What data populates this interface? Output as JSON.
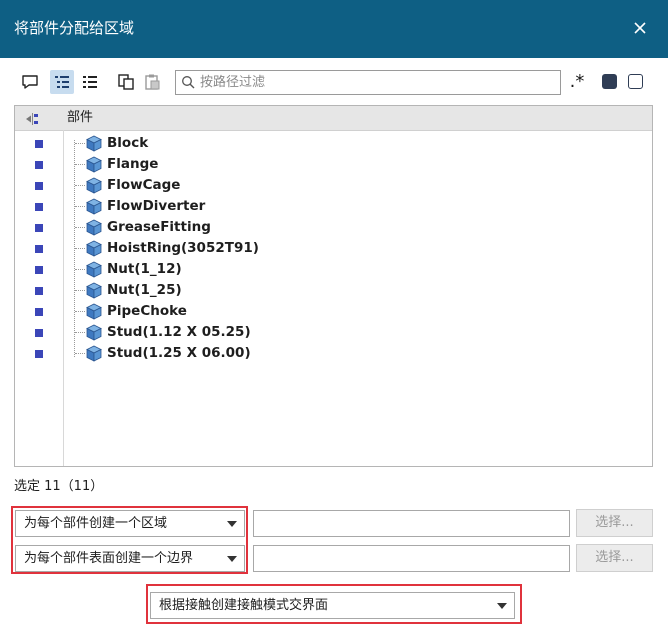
{
  "dialog": {
    "title": "将部件分配给区域"
  },
  "toolbar": {
    "search_placeholder": "按路径过滤",
    "regex_label": ".*"
  },
  "tree": {
    "header_label": "部件",
    "items": [
      {
        "label": "Block"
      },
      {
        "label": "Flange"
      },
      {
        "label": "FlowCage"
      },
      {
        "label": "FlowDiverter"
      },
      {
        "label": "GreaseFitting"
      },
      {
        "label": "HoistRing(3052T91)"
      },
      {
        "label": "Nut(1_12)"
      },
      {
        "label": "Nut(1_25)"
      },
      {
        "label": "PipeChoke"
      },
      {
        "label": "Stud(1.12 X 05.25)"
      },
      {
        "label": "Stud(1.25 X 06.00)"
      }
    ]
  },
  "status": {
    "text": "选定 11（11）"
  },
  "options": {
    "region_select": "为每个部件创建一个区域",
    "boundary_select": "为每个部件表面创建一个边界",
    "region_field_value": "",
    "boundary_field_value": "",
    "select_button_label": "选择...",
    "interface_select": "根据接触创建接触模式交界面"
  },
  "colors": {
    "titlebar": "#0e5f84",
    "marker": "#3b46b8",
    "highlight_border": "#e0323c"
  }
}
